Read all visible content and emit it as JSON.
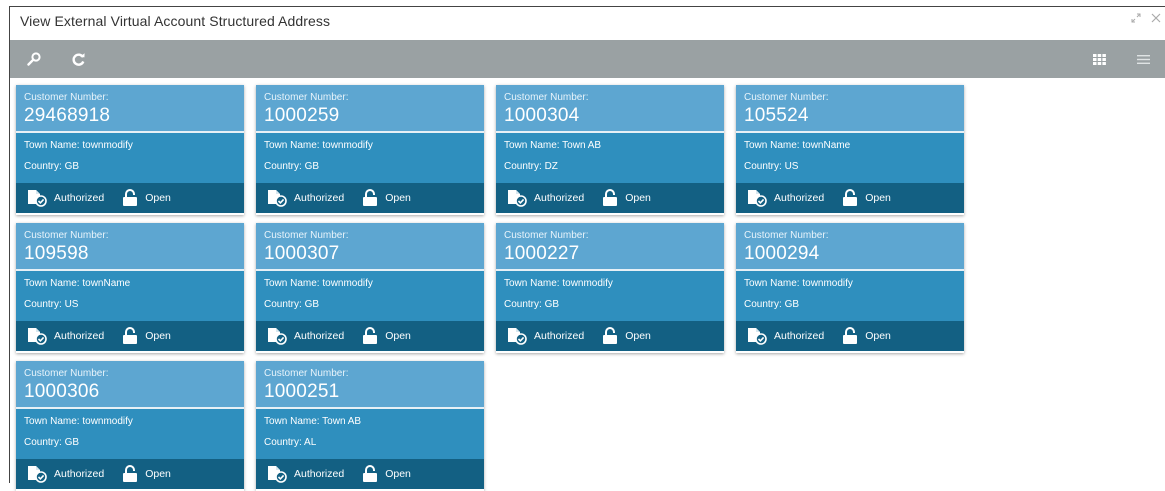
{
  "window": {
    "title": "View External Virtual Account Structured Address"
  },
  "toolbar": {
    "search_icon": "search-icon",
    "refresh_icon": "refresh-icon",
    "tile_view_icon": "grid-view-icon",
    "list_view_icon": "list-view-icon"
  },
  "labels": {
    "customer_number": "Customer Number:",
    "town_name_prefix": "Town Name: ",
    "country_prefix": "Country: "
  },
  "records": [
    {
      "customer_number": "29468918",
      "town_line": "Town Name: townmodify",
      "country_line": "Country: GB",
      "auth_status": "Authorized",
      "record_status": "Open"
    },
    {
      "customer_number": "1000259",
      "town_line": "Town Name: townmodify",
      "country_line": "Country: GB",
      "auth_status": "Authorized",
      "record_status": "Open"
    },
    {
      "customer_number": "1000304",
      "town_line": "Town Name: Town AB",
      "country_line": "Country: DZ",
      "auth_status": "Authorized",
      "record_status": "Open"
    },
    {
      "customer_number": "105524",
      "town_line": "Town Name: townName",
      "country_line": "Country: US",
      "auth_status": "Authorized",
      "record_status": "Open"
    },
    {
      "customer_number": "109598",
      "town_line": "Town Name: townName",
      "country_line": "Country: US",
      "auth_status": "Authorized",
      "record_status": "Open"
    },
    {
      "customer_number": "1000307",
      "town_line": "Town Name: townmodify",
      "country_line": "Country: GB",
      "auth_status": "Authorized",
      "record_status": "Open"
    },
    {
      "customer_number": "1000227",
      "town_line": "Town Name: townmodify",
      "country_line": "Country: GB",
      "auth_status": "Authorized",
      "record_status": "Open"
    },
    {
      "customer_number": "1000294",
      "town_line": "Town Name: townmodify",
      "country_line": "Country: GB",
      "auth_status": "Authorized",
      "record_status": "Open"
    },
    {
      "customer_number": "1000306",
      "town_line": "Town Name: townmodify",
      "country_line": "Country: GB",
      "auth_status": "Authorized",
      "record_status": "Open"
    },
    {
      "customer_number": "1000251",
      "town_line": "Town Name: Town AB",
      "country_line": "Country: AL",
      "auth_status": "Authorized",
      "record_status": "Open"
    }
  ],
  "colors": {
    "tile_header": "#5da6d1",
    "tile_body": "#2f8fbe",
    "tile_footer": "#136083",
    "toolbar": "#9aa1a3"
  }
}
